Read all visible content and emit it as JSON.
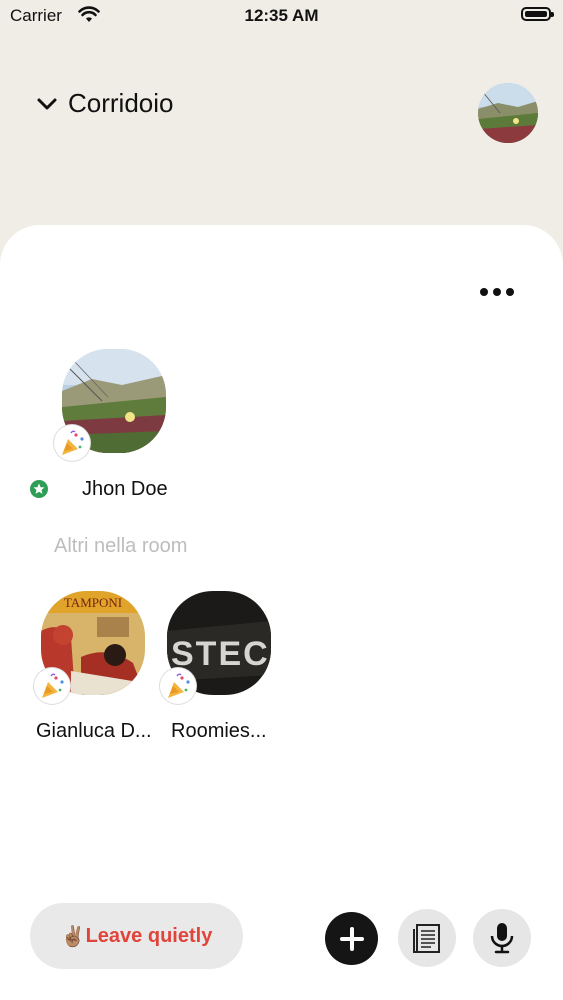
{
  "status_bar": {
    "carrier": "Carrier",
    "time": "12:35 AM"
  },
  "header": {
    "room_name": "Corridoio",
    "chevron_icon": "chevron-down-icon"
  },
  "menu": {
    "icon": "more-horizontal-icon"
  },
  "speaker": {
    "name": "Jhon Doe",
    "badge_icon": "party-popper-icon",
    "role_icon": "star-badge-icon"
  },
  "section": {
    "others_label": "Altri nella room"
  },
  "members": [
    {
      "name": "Gianluca D...",
      "badge_icon": "party-popper-icon"
    },
    {
      "name": "Roomies...",
      "badge_icon": "party-popper-icon"
    }
  ],
  "actions": {
    "leave_label": "Leave quietly",
    "leave_emoji": "✌🏽",
    "add_icon": "plus-icon",
    "notes_icon": "notes-icon",
    "mic_icon": "microphone-icon"
  },
  "colors": {
    "accent_red": "#e0443a",
    "header_bg": "#efede6",
    "star_green": "#2e9e57"
  }
}
